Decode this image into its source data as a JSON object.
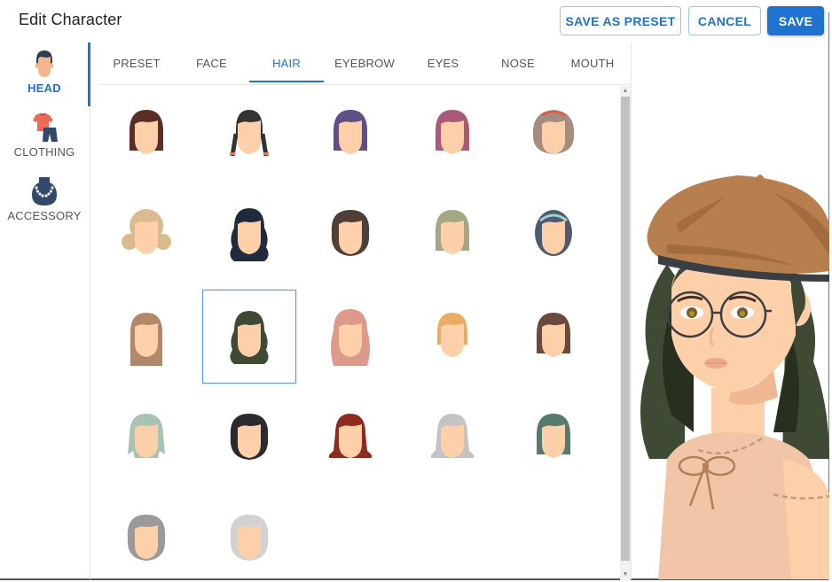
{
  "header": {
    "title": "Edit Character",
    "buttons": {
      "save_as_preset": "SAVE AS PRESET",
      "cancel": "CANCEL",
      "save": "SAVE"
    }
  },
  "categories": [
    {
      "id": "head",
      "label": "HEAD",
      "icon": "head-icon",
      "active": true
    },
    {
      "id": "clothing",
      "label": "CLOTHING",
      "icon": "tshirt-shorts-icon",
      "active": false
    },
    {
      "id": "accessory",
      "label": "ACCESSORY",
      "icon": "necklace-icon",
      "active": false
    }
  ],
  "tabs": [
    {
      "label": "PRESET",
      "active": false
    },
    {
      "label": "FACE",
      "active": false
    },
    {
      "label": "HAIR",
      "active": true
    },
    {
      "label": "EYEBROW",
      "active": false
    },
    {
      "label": "EYES",
      "active": false
    },
    {
      "label": "NOSE",
      "active": false
    },
    {
      "label": "MOUTH",
      "active": false
    }
  ],
  "hair_options": [
    {
      "style": "bob",
      "color": "#5a2e24",
      "selected": false
    },
    {
      "style": "braids",
      "color": "#333333",
      "selected": false
    },
    {
      "style": "straight-bangs",
      "color": "#5f4f86",
      "selected": false
    },
    {
      "style": "straight-bangs",
      "color": "#a95a79",
      "selected": false
    },
    {
      "style": "curly-headband",
      "color": "#a58b80",
      "selected": false
    },
    {
      "style": "buns",
      "color": "#d9bb8d",
      "selected": false
    },
    {
      "style": "long-wavy",
      "color": "#1f2b3c",
      "selected": false
    },
    {
      "style": "curly-round",
      "color": "#4e4037",
      "selected": false
    },
    {
      "style": "wavy-medium",
      "color": "#a3a784",
      "selected": false
    },
    {
      "style": "hijab",
      "color": "#4e5a6e",
      "selected": false
    },
    {
      "style": "long-straight",
      "color": "#b3876a",
      "selected": false
    },
    {
      "style": "long-wavy-dark",
      "color": "#3e4a33",
      "selected": true
    },
    {
      "style": "long-curly",
      "color": "#dd9a8b",
      "selected": false
    },
    {
      "style": "short-bob",
      "color": "#e8ad63",
      "selected": false
    },
    {
      "style": "shoulder-bangs",
      "color": "#6b4a3b",
      "selected": false
    },
    {
      "style": "shaggy",
      "color": "#a9c3b2",
      "selected": false
    },
    {
      "style": "curly-short",
      "color": "#2b2a2e",
      "selected": false
    },
    {
      "style": "flip",
      "color": "#8e2a1f",
      "selected": false
    },
    {
      "style": "flip-wide",
      "color": "#c3c3c3",
      "selected": false
    },
    {
      "style": "shoulder-straight",
      "color": "#557a6d",
      "selected": false
    },
    {
      "style": "curly-medium",
      "color": "#9a9a9a",
      "selected": false
    },
    {
      "style": "curly-medium",
      "color": "#d2d2d2",
      "selected": false
    }
  ],
  "colors": {
    "accent": "#1f73d0",
    "skin": "#fdd0aa"
  }
}
